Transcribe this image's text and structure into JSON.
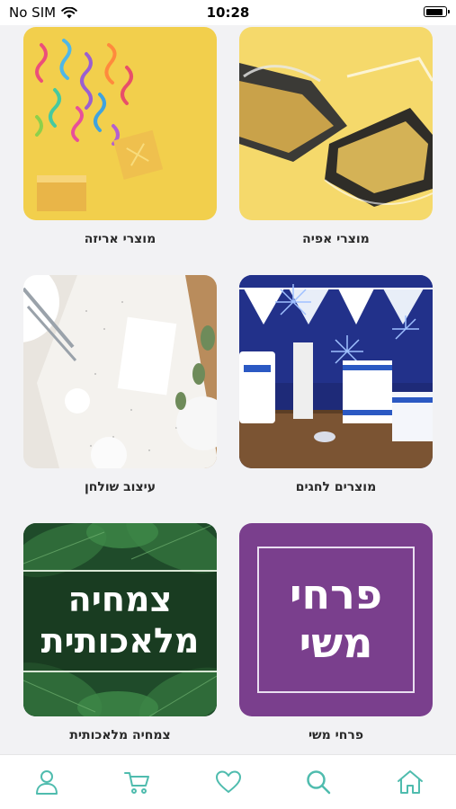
{
  "status_bar": {
    "carrier": "No SIM",
    "time": "10:28",
    "battery_level": 0.9
  },
  "categories": [
    {
      "label": "מוצרי אפיה"
    },
    {
      "label": "מוצרי אריזה"
    },
    {
      "label": "מוצרים לחגים"
    },
    {
      "label": "עיצוב שולחן"
    },
    {
      "label": "פרחי משי",
      "tile_text": "פרחי\nמשי",
      "tile_color": "#7a3f8d"
    },
    {
      "label": "צמחיה מלאכותית",
      "tile_text": "צמחיה\nמלאכותית",
      "tile_color": "#1f4b2a"
    }
  ],
  "tabbar": {
    "accent_color": "#4fbcae",
    "items": [
      {
        "icon": "user-icon"
      },
      {
        "icon": "cart-icon"
      },
      {
        "icon": "heart-icon"
      },
      {
        "icon": "search-icon"
      },
      {
        "icon": "home-icon"
      }
    ]
  }
}
